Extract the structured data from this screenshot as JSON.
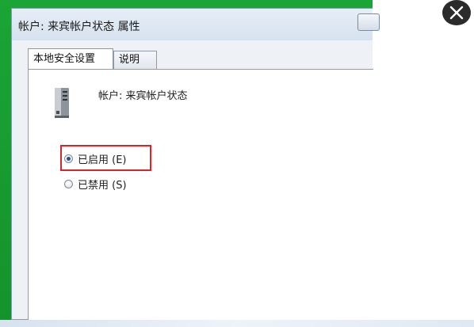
{
  "window": {
    "title": "帐户: 来宾帐户状态 属性"
  },
  "tabs": [
    {
      "label": "本地安全设置"
    },
    {
      "label": "说明"
    }
  ],
  "panel": {
    "account_label": "帐户: 来宾帐户状态",
    "options": [
      {
        "label": "已启用 (E)",
        "checked": true
      },
      {
        "label": "已禁用 (S)",
        "checked": false
      }
    ]
  },
  "colors": {
    "highlight": "#d8242a",
    "frame_green": "#1aa534"
  },
  "icons": {
    "server": "server-icon",
    "close": "close-icon"
  }
}
